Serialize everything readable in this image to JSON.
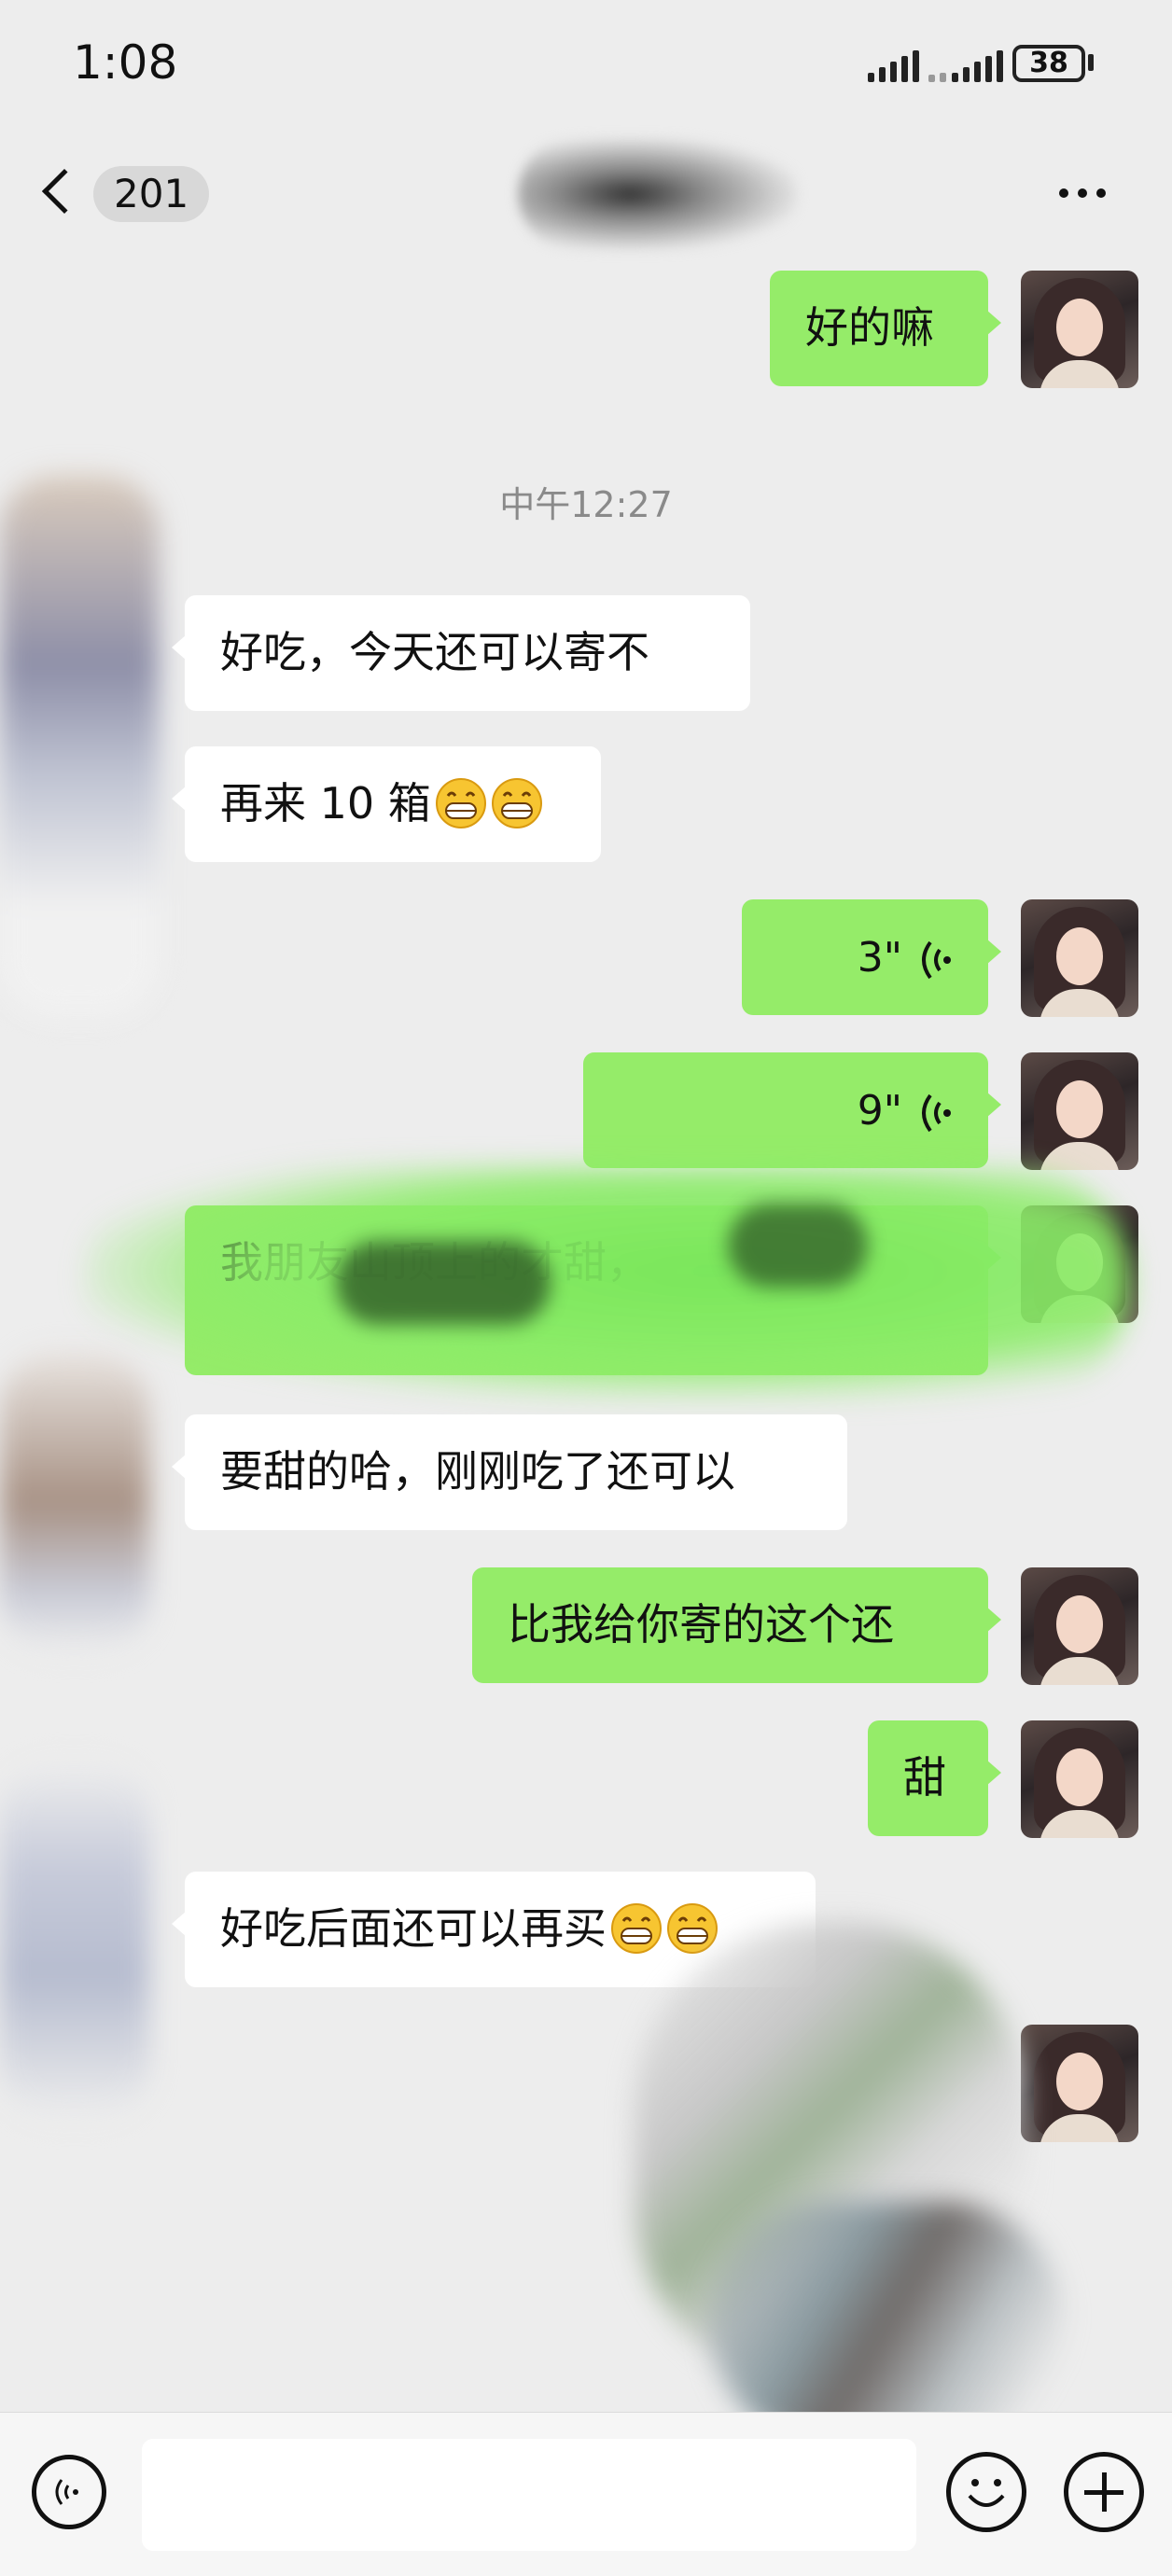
{
  "status_bar": {
    "time": "1:08",
    "battery": "38"
  },
  "nav": {
    "unread_count": "201"
  },
  "time_label": "中午12:27",
  "messages": {
    "m1": {
      "text": "好的嘛"
    },
    "m2": {
      "text": "好吃，今天还可以寄不"
    },
    "m3": {
      "text": "再来 10 箱",
      "emoji_count": 2
    },
    "m4": {
      "duration": "3\""
    },
    "m5": {
      "duration": "9\""
    },
    "m6": {
      "text": "我朋友山顶上的才甜，"
    },
    "m7": {
      "text": "要甜的哈，刚刚吃了还可以"
    },
    "m8": {
      "text": "比我给你寄的这个还"
    },
    "m9": {
      "text": "甜"
    },
    "m10": {
      "text": "好吃后面还可以再买",
      "emoji_count": 2
    }
  },
  "icons": {
    "back": "chevron-left-icon",
    "more": "more-dots-icon",
    "voice": "voice-wave-icon",
    "emoji": "grinning-emoji-icon",
    "input_voice": "voice-mode-icon",
    "input_emoji": "smiley-icon",
    "input_add": "plus-icon"
  },
  "colors": {
    "outgoing_bubble": "#95ec69",
    "incoming_bubble": "#ffffff",
    "background": "#ededed"
  }
}
